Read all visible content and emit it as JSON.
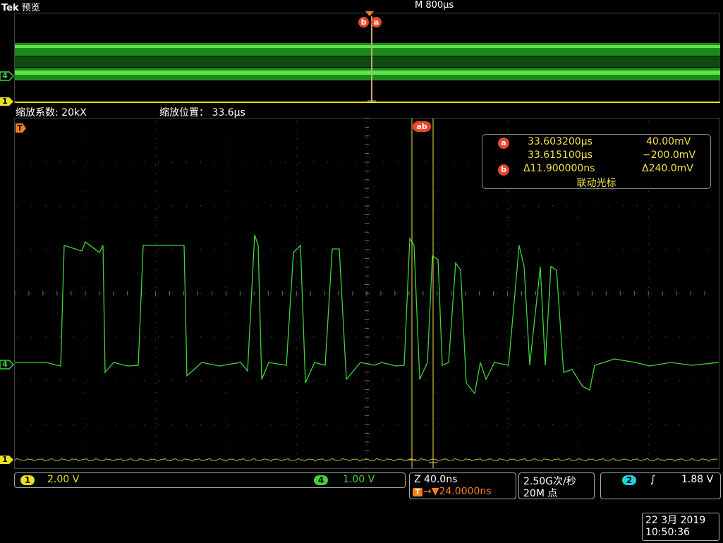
{
  "header": {
    "brand": "Tek",
    "mode": "预览",
    "timebase": "M 800μs"
  },
  "zoom": {
    "factor_label": "缩放系数: 20kX",
    "position_label": "缩放位置：",
    "position_value": "33.6μs"
  },
  "cursor_readout": {
    "a_badge": "a",
    "b_badge": "b",
    "a_time": "33.603200μs",
    "a_volt": "40.00mV",
    "b_time": "33.615100μs",
    "b_volt": "−200.0mV",
    "delta_time": "Δ11.900000ns",
    "delta_volt": "Δ240.0mV",
    "mode": "联动光标"
  },
  "markers": {
    "trigger": "T",
    "ch4": "4",
    "ch1": "1",
    "cursor_b": "b",
    "cursor_a": "a",
    "cursors_ab": "ab"
  },
  "bottom": {
    "ch1_badge": "1",
    "ch1_scale": "2.00 V",
    "ch4_badge": "4",
    "ch4_scale": "1.00 V",
    "zoom_scale": "Z 40.0ns",
    "trigger_offset_badge": "T",
    "trigger_offset": "→▼24.0000ns",
    "sample_rate": "2.50G次/秒",
    "record_length": "20M 点",
    "trig_source_badge": "2",
    "trig_slope": "∫",
    "trig_level": "1.88 V"
  },
  "datetime": {
    "date": "22 3月  2019",
    "time": "10:50:36"
  },
  "colors": {
    "ch1": "#e8e020",
    "ch4": "#3fd43a",
    "cursor": "#f0e040",
    "cursor_badge": "#e8482a",
    "trig_source": "#20d0e0",
    "trigger_marker": "#f08020"
  }
}
